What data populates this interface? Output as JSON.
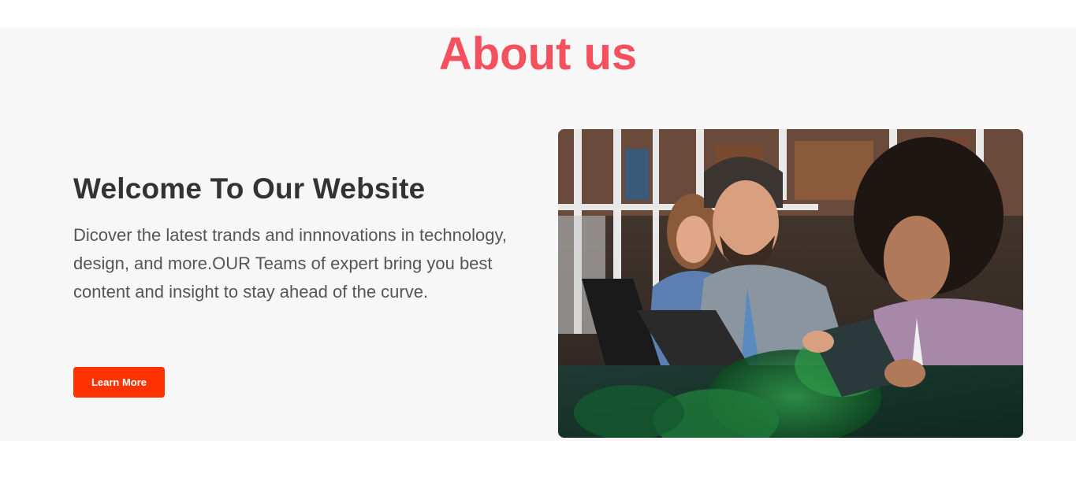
{
  "about": {
    "title": "About us",
    "welcome_heading": "Welcome To Our Website",
    "welcome_text": "Dicover the latest trands and innnovations in technology, design, and more.OUR Teams of expert bring you best content and insight to stay ahead of the curve.",
    "learn_more_label": "Learn More"
  },
  "colors": {
    "title": "#f4505e",
    "button": "#ff3300",
    "section_bg": "#f7f7f7"
  }
}
